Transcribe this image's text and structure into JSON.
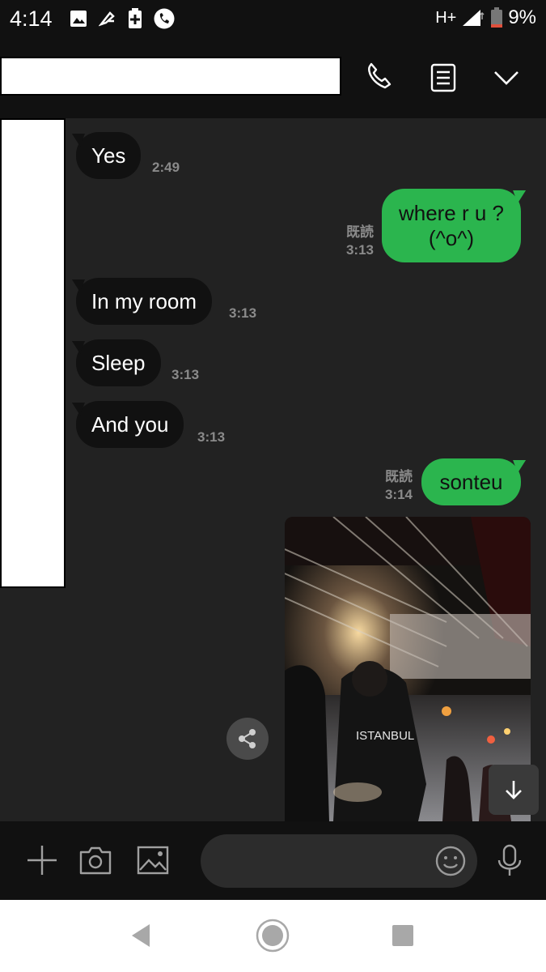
{
  "status_bar": {
    "time": "4:14",
    "network": "H+",
    "battery": "9%"
  },
  "header": {
    "icons": [
      "phone-icon",
      "notes-icon",
      "chevron-down-icon"
    ]
  },
  "messages": [
    {
      "direction": "in",
      "text": "Yes",
      "time": "2:49"
    },
    {
      "direction": "out",
      "lines": [
        "where r u ?",
        "(^o^)"
      ],
      "read": "既読",
      "time": "3:13"
    },
    {
      "direction": "in",
      "text": "In my room",
      "time": "3:13"
    },
    {
      "direction": "in",
      "text": "Sleep",
      "time": "3:13"
    },
    {
      "direction": "in",
      "text": "And you",
      "time": "3:13"
    },
    {
      "direction": "out",
      "text": "sonteu",
      "read": "既読",
      "time": "3:14"
    },
    {
      "direction": "out",
      "type": "photo",
      "photo_text": "ISTANBUL"
    }
  ],
  "input_bar": {
    "placeholder": "",
    "icons": [
      "plus-icon",
      "camera-icon",
      "image-icon",
      "emoji-icon",
      "mic-icon"
    ]
  },
  "colors": {
    "background": "#222222",
    "bar": "#111111",
    "incoming_bubble": "#111111",
    "outgoing_bubble": "#2bb54e"
  }
}
